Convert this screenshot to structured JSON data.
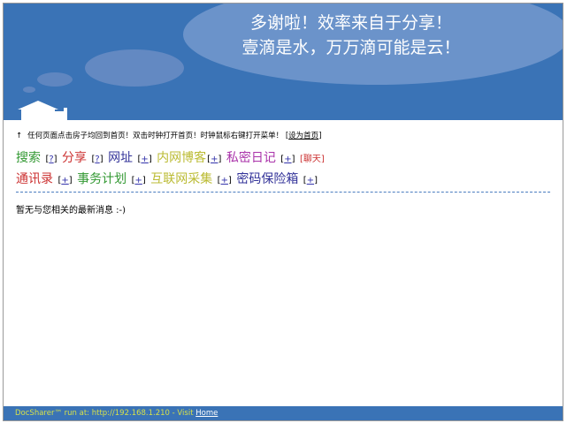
{
  "header": {
    "slogan_line1": "多谢啦！效率来自于分享！",
    "slogan_line2": "壹滴是水，万万滴可能是云！"
  },
  "instruction": {
    "text": "任何页面点击房子均回到首页！双击时钟打开首页！时钟鼠标右键打开菜单！",
    "bracket_open": "[",
    "set_home": "设为首页",
    "bracket_close": "]"
  },
  "menu": {
    "search": "搜索",
    "share": "分享",
    "url": "网址",
    "blog": "内网博客",
    "diary": "私密日记",
    "chat": "[聊天]",
    "contacts": "通讯录",
    "plan": "事务计划",
    "web": "互联网采集",
    "password": "密码保险箱",
    "help_mark": "?",
    "plus_mark": "+",
    "bracket_open": "[",
    "bracket_close": "]"
  },
  "message": {
    "none": "暂无与您相关的最新消息 :-)"
  },
  "footer": {
    "text": "DocSharer™ run at: http://192.168.1.210 - Visit ",
    "home_link": "Home"
  },
  "colors": {
    "header_bg": "#3a73b6",
    "search": "#339933",
    "share": "#cc3333",
    "url": "#333399",
    "blog": "#bbbb33",
    "diary": "#aa33aa"
  }
}
